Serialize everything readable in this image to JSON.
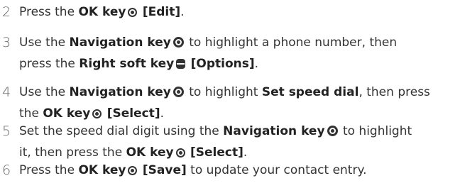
{
  "steps": [
    {
      "number": "2",
      "t1": "Press the ",
      "b1": "OK key",
      "t2": " ",
      "b2": "[Edit]",
      "t3": "."
    },
    {
      "number": "3",
      "t1": "Use the ",
      "b1": "Navigation key",
      "t2": " to highlight a phone number, then",
      "t3": "press the ",
      "b2": "Right soft key",
      "t4": " ",
      "b3": "[Options]",
      "t5": "."
    },
    {
      "number": "4",
      "t1": "Use the ",
      "b1": "Navigation key",
      "t2": " to highlight ",
      "b2": "Set speed dial",
      "t3": ", then press",
      "t4": "the ",
      "b3": "OK key",
      "t5": " ",
      "b4": "[Select]",
      "t6": "."
    },
    {
      "number": "5",
      "t1": "Set the speed dial digit using the ",
      "b1": "Navigation key",
      "t2": " to highlight",
      "t3": "it, then press the ",
      "b2": "OK key",
      "t4": " ",
      "b3": "[Select]",
      "t5": "."
    },
    {
      "number": "6",
      "t1": "Press the ",
      "b1": "OK key",
      "t2": " ",
      "b2": "[Save]",
      "t3": " to update your contact entry."
    }
  ],
  "icons": {
    "ok_key": "ok-key-icon",
    "navigation_key": "navigation-key-icon",
    "right_soft_key": "right-soft-key-icon"
  }
}
